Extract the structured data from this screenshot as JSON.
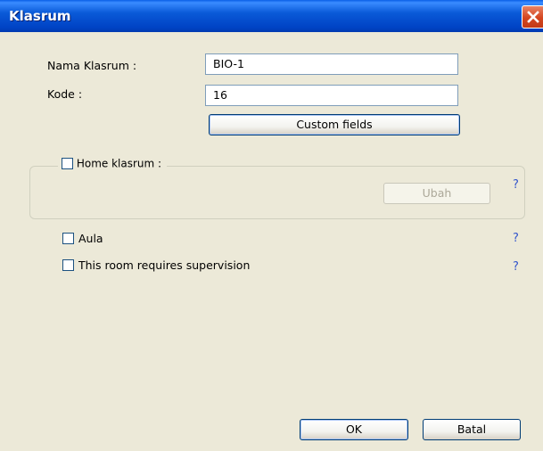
{
  "window": {
    "title": "Klasrum",
    "close_icon": "close-icon"
  },
  "form": {
    "name_label": "Nama Klasrum :",
    "name_value": "BIO-1",
    "code_label": "Kode :",
    "code_value": "16",
    "custom_fields_label": "Custom fields"
  },
  "home_group": {
    "checkbox_label": "Home klasrum :",
    "checked": false,
    "change_label": "Ubah",
    "change_enabled": false,
    "help": "?"
  },
  "options": [
    {
      "label": "Aula",
      "checked": false,
      "help": "?"
    },
    {
      "label": "This room requires supervision",
      "checked": false,
      "help": "?"
    }
  ],
  "footer": {
    "ok_label": "OK",
    "cancel_label": "Batal"
  },
  "colors": {
    "titlebar": "#0054E3",
    "dialog_bg": "#ECE9D8",
    "button_border": "#003C74",
    "help_link": "#3355CC",
    "close_button": "#D4451F"
  }
}
